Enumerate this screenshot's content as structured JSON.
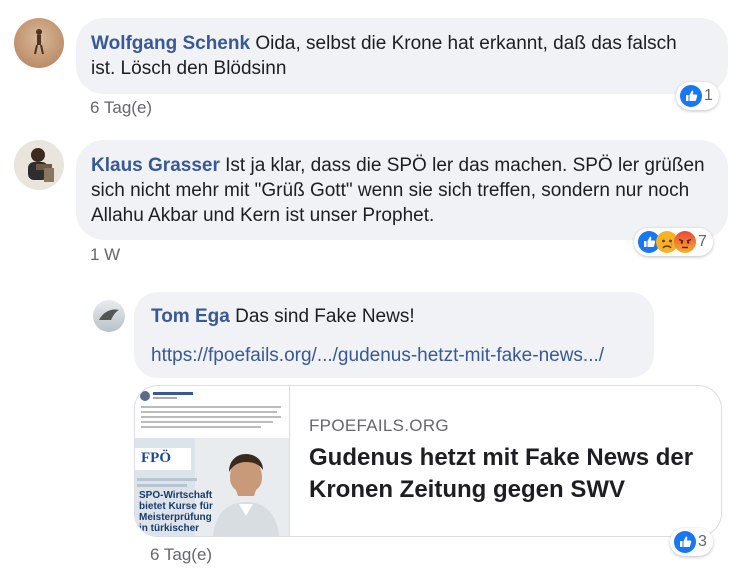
{
  "comments": [
    {
      "author": "Wolfgang Schenk",
      "text": "Oida, selbst die Krone hat erkannt, daß das falsch ist. Lösch den Blödsinn",
      "time": "6 Tag(e)",
      "reaction_count": "1",
      "reactions": [
        "like-icon"
      ]
    },
    {
      "author": "Klaus Grasser",
      "text": "Ist ja klar, dass die SPÖ ler das machen. SPÖ ler grüßen sich nicht mehr mit \"Grüß Gott\" wenn sie sich treffen, sondern nur noch Allahu Akbar und Kern ist unser Prophet.",
      "time": "1 W",
      "reaction_count": "7",
      "reactions": [
        "like-icon",
        "sad-icon",
        "angry-icon"
      ]
    }
  ],
  "reply": {
    "author": "Tom Ega",
    "text": "Das sind Fake News!",
    "link_text": "https://fpoefails.org/.../gudenus-hetzt-mit-fake-news.../",
    "time": "6 Tag(e)",
    "reaction_count": "3",
    "reactions": [
      "like-icon"
    ]
  },
  "link_card": {
    "domain": "FPOEFAILS.ORG",
    "title": "Gudenus hetzt mit Fake News der Kronen Zeitung gegen SWV",
    "thumb_overlay": "SPÖ-Wirtschaft bietet Kurse für Meisterprüfung in türkischer",
    "thumb_logo": "FPÖ"
  },
  "colors": {
    "bubble": "#f0f2f5",
    "author": "#385898",
    "like": "#1877f2",
    "meta": "#65676b"
  }
}
